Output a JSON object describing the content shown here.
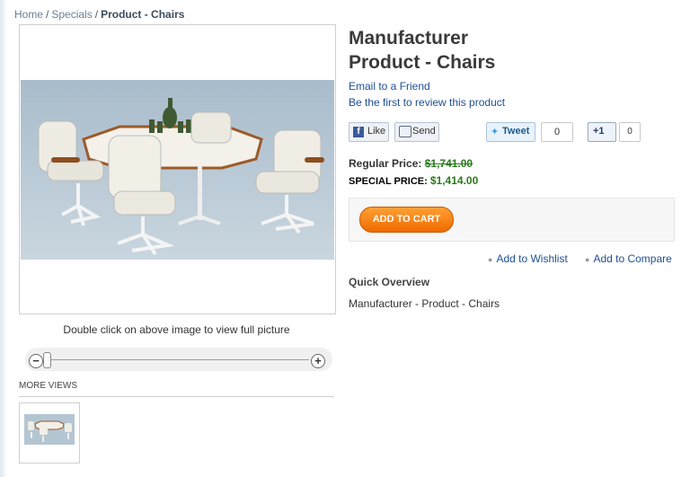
{
  "breadcrumb": {
    "home": "Home",
    "specials": "Specials",
    "current": "Product - Chairs",
    "separator": "/"
  },
  "product": {
    "title_line1": "Manufacturer",
    "title_line2": "Product - Chairs",
    "email_link": "Email to a Friend",
    "review_link": "Be the first to review this product",
    "image_hint": "Double click on above image to view full picture",
    "more_views": "MORE VIEWS"
  },
  "social": {
    "fb_icon": "f",
    "like": "Like",
    "send": "Send",
    "tweet": "Tweet",
    "tweet_count": "0",
    "gplus": "+1",
    "gplus_count": "0"
  },
  "zoom": {
    "out": "−",
    "in": "+"
  },
  "price": {
    "regular_label": "Regular Price:",
    "regular_value": "$1,741.00",
    "special_label": "SPECIAL PRICE:",
    "special_value": "$1,414.00"
  },
  "actions": {
    "add_to_cart": "ADD TO CART",
    "wishlist": "Add to Wishlist",
    "compare": "Add to Compare",
    "bullet": "●"
  },
  "overview": {
    "title": "Quick Overview",
    "text": "Manufacturer - Product - Chairs"
  },
  "colors": {
    "link": "#1d4f93",
    "price_green": "#2a7a1c",
    "cart_orange": "#f07a00"
  }
}
